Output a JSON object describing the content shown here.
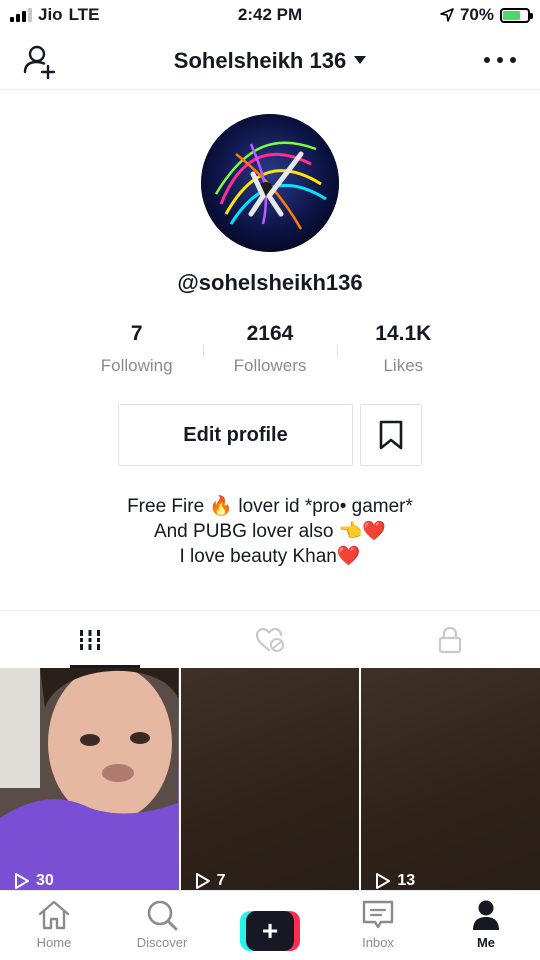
{
  "status_bar": {
    "carrier": "Jio",
    "network": "LTE",
    "time": "2:42 PM",
    "battery": "70%",
    "battery_level": 0.7
  },
  "header": {
    "title": "Sohelsheikh 136",
    "icons": [
      "add-user-icon",
      "chevron-down-icon",
      "more-icon"
    ]
  },
  "profile": {
    "username": "@sohelsheikh136",
    "stats": [
      {
        "value": "7",
        "label": "Following"
      },
      {
        "value": "2164",
        "label": "Followers"
      },
      {
        "value": "14.1K",
        "label": "Likes"
      }
    ],
    "edit_button": "Edit profile",
    "bio": {
      "line1": "Free Fire 🔥 lover id *pro• gamer*",
      "line2": "And PUBG lover also 👈❤️",
      "line3": "I love beauty Khan❤️"
    }
  },
  "tabs": [
    "grid-icon",
    "liked-hidden-icon",
    "lock-icon"
  ],
  "videos": [
    {
      "plays": "30"
    },
    {
      "plays": "7"
    },
    {
      "plays": "13"
    }
  ],
  "bottom_nav": [
    {
      "label": "Home",
      "icon": "home-icon"
    },
    {
      "label": "Discover",
      "icon": "search-icon"
    },
    {
      "label": "",
      "icon": "plus-icon"
    },
    {
      "label": "Inbox",
      "icon": "inbox-icon"
    },
    {
      "label": "Me",
      "icon": "person-icon",
      "active": true
    }
  ],
  "colors": {
    "accent_cyan": "#25f4ee",
    "accent_red": "#fe2c55",
    "text": "#161823",
    "muted": "#8a8b91",
    "battery": "#4cd964"
  }
}
